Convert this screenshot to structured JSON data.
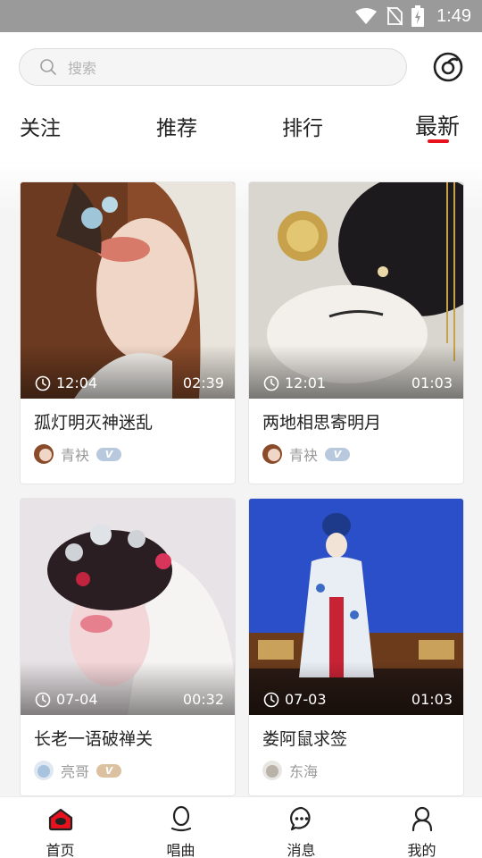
{
  "status_bar": {
    "time": "1:49"
  },
  "search": {
    "placeholder": "搜索"
  },
  "tabs": [
    {
      "label": "关注",
      "active": false
    },
    {
      "label": "推荐",
      "active": false
    },
    {
      "label": "排行",
      "active": false
    },
    {
      "label": "最新",
      "active": true
    }
  ],
  "cards": [
    {
      "title": "孤灯明灭神迷乱",
      "time": "12:04",
      "duration": "02:39",
      "user": "青袂",
      "badge": "V"
    },
    {
      "title": "两地相思寄明月",
      "time": "12:01",
      "duration": "01:03",
      "user": "青袂",
      "badge": "V"
    },
    {
      "title": "长老一语破禅关",
      "time": "07-04",
      "duration": "00:32",
      "user": "亮哥",
      "badge": "V"
    },
    {
      "title": "娄阿鼠求签",
      "time": "07-03",
      "duration": "01:03",
      "user": "东海",
      "badge": ""
    }
  ],
  "nav": [
    {
      "label": "首页",
      "icon": "home-icon"
    },
    {
      "label": "唱曲",
      "icon": "microphone-icon"
    },
    {
      "label": "消息",
      "icon": "message-icon"
    },
    {
      "label": "我的",
      "icon": "profile-icon"
    }
  ],
  "colors": {
    "accent": "#e8121f",
    "badge_blue": "#b9c9dd",
    "badge_gold": "#dcc1a0"
  }
}
